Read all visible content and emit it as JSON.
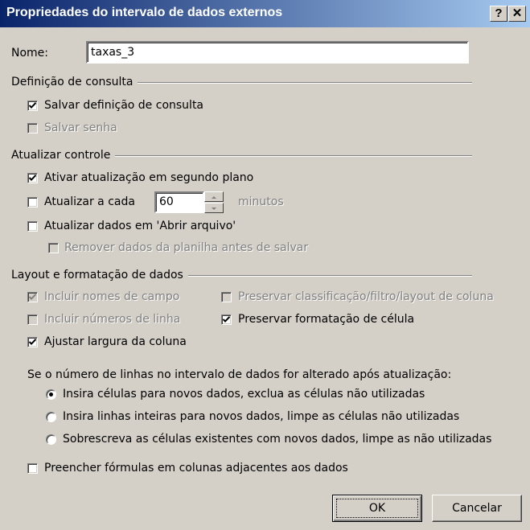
{
  "dialog": {
    "title": "Propriedades do intervalo de dados externos"
  },
  "titlebar": {
    "help": "?",
    "close": "✕"
  },
  "name": {
    "label": "Nome:",
    "value": "taxas_3"
  },
  "query_definition": {
    "legend": "Definição de consulta",
    "save_query": {
      "label": "Salvar definição de consulta",
      "checked": true,
      "enabled": true
    },
    "save_password": {
      "label": "Salvar senha",
      "checked": false,
      "enabled": false
    }
  },
  "refresh_control": {
    "legend": "Atualizar controle",
    "background": {
      "label": "Ativar atualização em segundo plano",
      "checked": true
    },
    "every": {
      "label": "Atualizar a cada",
      "checked": false,
      "value": "60",
      "unit": "minutos"
    },
    "on_open": {
      "label": "Atualizar dados em 'Abrir arquivo'",
      "checked": false
    },
    "remove_before_save": {
      "label": "Remover dados da planilha antes de salvar",
      "checked": false,
      "enabled": false
    }
  },
  "layout": {
    "legend": "Layout e formatação de dados",
    "include_field_names": {
      "label": "Incluir nomes de campo",
      "checked": true,
      "enabled": false
    },
    "include_row_numbers": {
      "label": "Incluir números de linha",
      "checked": false,
      "enabled": false
    },
    "adjust_column_width": {
      "label": "Ajustar largura da coluna",
      "checked": true
    },
    "preserve_sort": {
      "label": "Preservar classificação/filtro/layout de coluna",
      "checked": false,
      "enabled": false
    },
    "preserve_format": {
      "label": "Preservar formatação de célula",
      "checked": true
    }
  },
  "row_change": {
    "prompt": "Se o número de linhas no intervalo de dados for alterado após atualização:",
    "options": [
      {
        "label": "Insira células para novos dados, exclua as células não utilizadas",
        "selected": true
      },
      {
        "label": "Insira linhas inteiras para novos dados, limpe as células não utilizadas",
        "selected": false
      },
      {
        "label": "Sobrescreva as células existentes com novos dados, limpe as não utilizadas",
        "selected": false
      }
    ]
  },
  "fill_formulas": {
    "label": "Preencher fórmulas em colunas adjacentes aos dados",
    "checked": false
  },
  "buttons": {
    "ok": "OK",
    "cancel": "Cancelar"
  }
}
